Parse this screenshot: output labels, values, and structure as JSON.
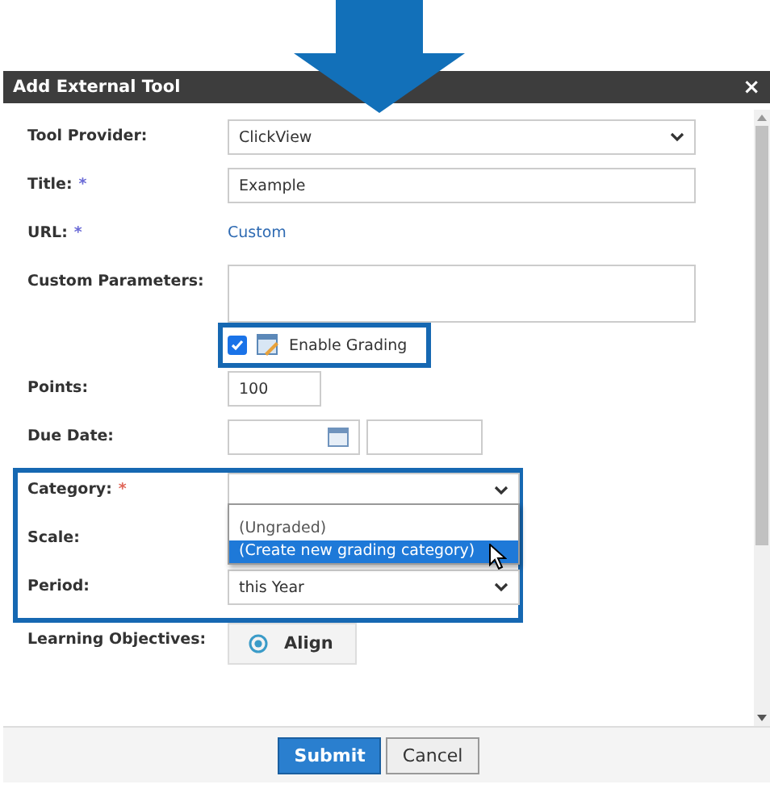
{
  "dialog": {
    "title": "Add External Tool",
    "close": "×"
  },
  "sections": [
    {
      "highlighted": false,
      "fields": [
        {
          "kind": "select",
          "label": "Tool Provider:",
          "value": "ClickView"
        },
        {
          "kind": "text",
          "label": "Title:",
          "required_mark": "*",
          "color": "#6b6bd6",
          "value": "Example"
        },
        {
          "kind": "link",
          "label": "URL:",
          "required_mark": "*",
          "color": "#6b6bd6",
          "value": "Custom"
        },
        {
          "kind": "textarea",
          "label": "Custom Parameters:"
        },
        {
          "kind": "checkbox",
          "text": "Enable Grading",
          "checked": true,
          "highlighted": true
        },
        {
          "kind": "short",
          "label": "Points:",
          "value": "100"
        },
        {
          "kind": "date",
          "label": "Due Date:"
        }
      ]
    },
    {
      "highlighted": true,
      "fields": [
        {
          "kind": "select",
          "label": "Category:",
          "required_mark": "*",
          "color": "#e0675a",
          "open": true,
          "options": [
            {
              "label": "(Ungraded)",
              "selected": false
            },
            {
              "label": "(Create new grading category)",
              "selected": true
            }
          ]
        },
        {
          "kind": "select",
          "label": "Scale:"
        },
        {
          "kind": "select",
          "label": "Period:",
          "value": "this Year"
        }
      ]
    },
    {
      "highlighted": false,
      "fields": [
        {
          "kind": "button",
          "label": "Learning Objectives:",
          "value": "Align"
        }
      ]
    }
  ],
  "buttons": [
    {
      "label": "Submit",
      "primary": true
    },
    {
      "label": "Cancel",
      "primary": false
    }
  ]
}
